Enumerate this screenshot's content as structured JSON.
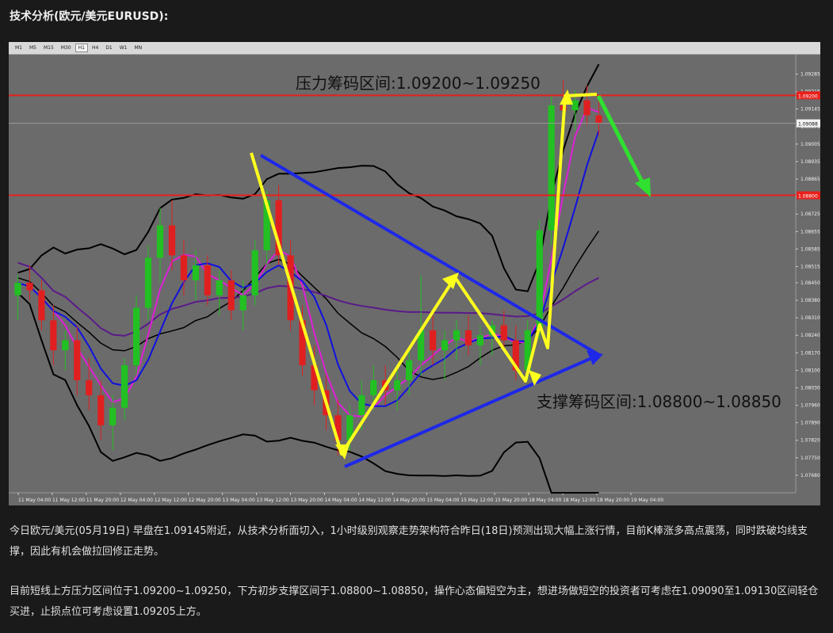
{
  "heading": "技术分析(欧元/美元EURUSD):",
  "toolbar": {
    "timeframes": [
      "M1",
      "M5",
      "M15",
      "M30",
      "H1",
      "H4",
      "D1",
      "W1",
      "MN"
    ],
    "active": "H1"
  },
  "chart_data": {
    "type": "candlestick",
    "symbol": "EURUSD",
    "timeframe": "H1",
    "ylim": [
      1.0761,
      1.0935
    ],
    "y_ticks": [
      "1.09285",
      "1.09215",
      "1.09145",
      "1.09075",
      "1.09005",
      "1.08935",
      "1.08865",
      "1.08795",
      "1.08725",
      "1.08655",
      "1.08585",
      "1.08515",
      "1.08450",
      "1.08380",
      "1.08310",
      "1.08240",
      "1.08170",
      "1.08100",
      "1.08030",
      "1.07960",
      "1.07890",
      "1.07820",
      "1.07750",
      "1.07680",
      "1.07615"
    ],
    "x_ticks": [
      "11 May 04:00",
      "11 May 12:00",
      "11 May 20:00",
      "12 May 04:00",
      "12 May 12:00",
      "12 May 20:00",
      "13 May 04:00",
      "13 May 12:00",
      "13 May 20:00",
      "14 May 04:00",
      "14 May 12:00",
      "14 May 20:00",
      "15 May 04:00",
      "15 May 12:00",
      "15 May 20:00",
      "18 May 04:00",
      "18 May 12:00",
      "18 May 20:00",
      "19 May 04:00"
    ],
    "price_tags": {
      "resistance_line": "1.09200",
      "current": "1.09088",
      "support_line": "1.08800"
    },
    "candles": [
      [
        1.084,
        1.0848,
        1.083,
        1.0845
      ],
      [
        1.0845,
        1.0852,
        1.0838,
        1.0842
      ],
      [
        1.0842,
        1.0846,
        1.0826,
        1.083
      ],
      [
        1.083,
        1.0836,
        1.0812,
        1.0818
      ],
      [
        1.0818,
        1.0826,
        1.081,
        1.0822
      ],
      [
        1.0822,
        1.0828,
        1.08,
        1.0806
      ],
      [
        1.0806,
        1.0815,
        1.0794,
        1.08
      ],
      [
        1.08,
        1.0806,
        1.0782,
        1.0788
      ],
      [
        1.0788,
        1.08,
        1.0778,
        1.0795
      ],
      [
        1.0795,
        1.0815,
        1.079,
        1.0812
      ],
      [
        1.0812,
        1.084,
        1.0808,
        1.0835
      ],
      [
        1.0835,
        1.086,
        1.083,
        1.0855
      ],
      [
        1.0855,
        1.0875,
        1.0845,
        1.0868
      ],
      [
        1.0868,
        1.0878,
        1.085,
        1.0856
      ],
      [
        1.0856,
        1.0862,
        1.084,
        1.0846
      ],
      [
        1.0846,
        1.0858,
        1.0838,
        1.0852
      ],
      [
        1.0852,
        1.0856,
        1.0836,
        1.084
      ],
      [
        1.084,
        1.085,
        1.0832,
        1.0846
      ],
      [
        1.0846,
        1.085,
        1.083,
        1.0834
      ],
      [
        1.0834,
        1.0846,
        1.0826,
        1.084
      ],
      [
        1.084,
        1.0862,
        1.0836,
        1.0858
      ],
      [
        1.0858,
        1.0882,
        1.0852,
        1.0878
      ],
      [
        1.0878,
        1.0884,
        1.0852,
        1.0856
      ],
      [
        1.0856,
        1.0862,
        1.0826,
        1.083
      ],
      [
        1.083,
        1.0836,
        1.0808,
        1.0812
      ],
      [
        1.0812,
        1.082,
        1.0796,
        1.0802
      ],
      [
        1.0802,
        1.0808,
        1.0786,
        1.0792
      ],
      [
        1.0792,
        1.0798,
        1.0776,
        1.0782
      ],
      [
        1.0782,
        1.0796,
        1.0778,
        1.0792
      ],
      [
        1.0792,
        1.0806,
        1.0786,
        1.08
      ],
      [
        1.08,
        1.0812,
        1.0794,
        1.0806
      ],
      [
        1.0806,
        1.0812,
        1.0796,
        1.0802
      ],
      [
        1.0802,
        1.081,
        1.0794,
        1.0806
      ],
      [
        1.0806,
        1.0818,
        1.08,
        1.0814
      ],
      [
        1.0814,
        1.0848,
        1.0808,
        1.0826
      ],
      [
        1.0826,
        1.0832,
        1.0812,
        1.0818
      ],
      [
        1.0818,
        1.0826,
        1.0806,
        1.0822
      ],
      [
        1.0822,
        1.083,
        1.0814,
        1.0826
      ],
      [
        1.0826,
        1.0832,
        1.0816,
        1.082
      ],
      [
        1.082,
        1.0828,
        1.0812,
        1.0824
      ],
      [
        1.0824,
        1.083,
        1.0816,
        1.0828
      ],
      [
        1.0828,
        1.0834,
        1.0818,
        1.0822
      ],
      [
        1.0822,
        1.0828,
        1.0806,
        1.081
      ],
      [
        1.081,
        1.083,
        1.0806,
        1.0826
      ],
      [
        1.0826,
        1.087,
        1.0822,
        1.0866
      ],
      [
        1.0866,
        1.092,
        1.086,
        1.0916
      ],
      [
        1.0916,
        1.0926,
        1.0908,
        1.0914
      ],
      [
        1.0914,
        1.0922,
        1.0906,
        1.0918
      ],
      [
        1.0918,
        1.0924,
        1.0908,
        1.0912
      ],
      [
        1.0912,
        1.0918,
        1.0904,
        1.0909
      ]
    ],
    "indicators": [
      "Bollinger Bands",
      "Moving Average (blue)",
      "Moving Average (magenta)",
      "Moving Average (purple)",
      "Moving Average (black)"
    ],
    "annotations": {
      "resistance_zone": "压力筹码区间:1.09200~1.09250",
      "support_zone": "支撑筹码区间:1.08800~1.08850"
    },
    "colors": {
      "background": "#6b6b6b",
      "bull": "#22c022",
      "bear": "#e02020",
      "resistance": "#e8201c",
      "support_arrow": "#1e28e8",
      "wave": "#ffff1e",
      "forecast": "#30e030",
      "band": "#000000",
      "ma_fast": "#1010e0",
      "ma_mid": "#e020d8",
      "ma_slow": "#5a1a8a"
    }
  },
  "paragraphs": [
    "今日欧元/美元(05月19日) 早盘在1.09145附近，从技术分析面切入，1小时级别观察走势架构符合昨日(18日)预测出现大幅上涨行情，目前K棒涨多高点震荡，同时跌破均线支撑，因此有机会做拉回修正走势。",
    "目前短线上方压力区间位于1.09200~1.09250，下方初步支撑区间于1.08800~1.08850，操作心态偏短空为主，想进场做短空的投资者可考虑在1.09090至1.09130区间轻仓买进，止损点位可考虑设置1.09205上方。"
  ]
}
